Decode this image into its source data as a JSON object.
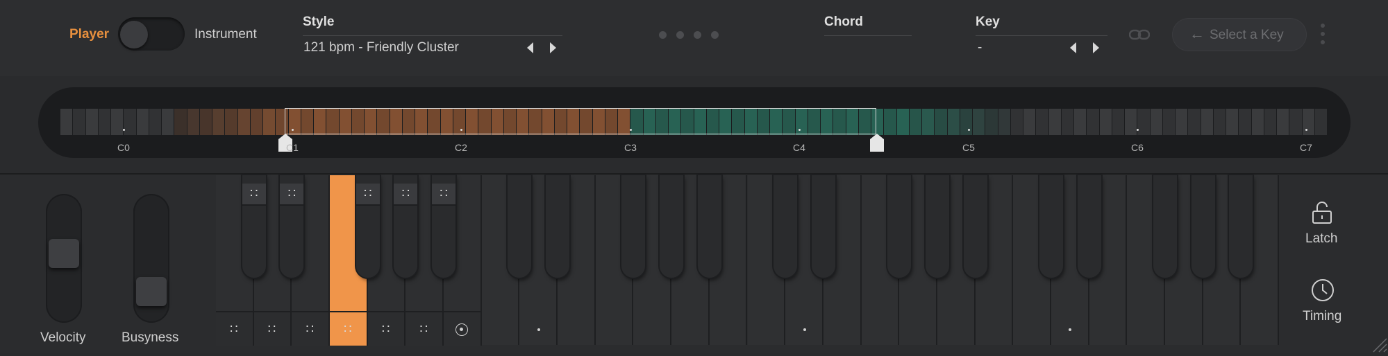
{
  "mode_toggle": {
    "left_label": "Player",
    "right_label": "Instrument",
    "active": "Player"
  },
  "style": {
    "header": "Style",
    "value": "121 bpm - Friendly Cluster"
  },
  "page_dots": 4,
  "chord": {
    "header": "Chord",
    "value": ""
  },
  "key": {
    "header": "Key",
    "value": "-"
  },
  "select_key_button": {
    "label": "Select a Key"
  },
  "octave_labels": [
    "C0",
    "C1",
    "C2",
    "C3",
    "C4",
    "C5",
    "C6",
    "C7"
  ],
  "sliders": [
    {
      "label": "Velocity",
      "level": 0.55
    },
    {
      "label": "Busyness",
      "level": 0.15
    }
  ],
  "side_buttons": [
    {
      "label": "Latch",
      "icon": "unlock-icon"
    },
    {
      "label": "Timing",
      "icon": "clock-icon"
    }
  ],
  "colors": {
    "accent_orange": "#f0954a",
    "accent_teal": "#2e6b5c",
    "active_label": "#e8903e"
  }
}
